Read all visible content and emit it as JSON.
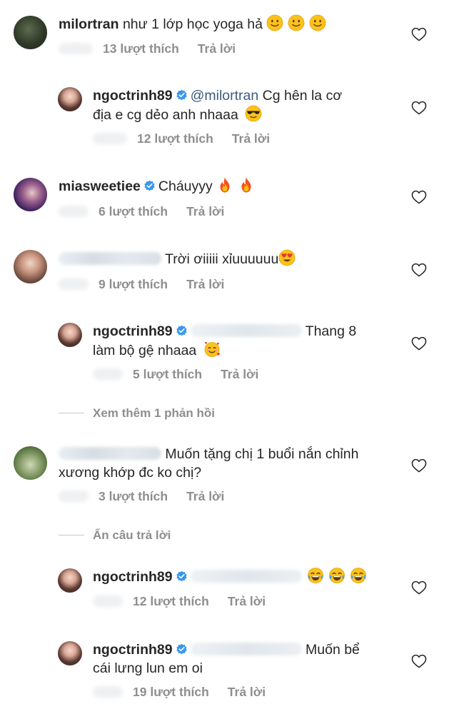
{
  "comments": [
    {
      "username": "milortran",
      "text": "như 1 lớp học yoga hả",
      "likes": "13 lượt thích",
      "reply_label": "Trả lời",
      "emojis": [
        "slightly-smiling-face",
        "slightly-smiling-face",
        "slightly-smiling-face"
      ]
    },
    {
      "username": "ngoctrinh89",
      "mention": "@milortran",
      "text_line1": "Cg hên la cơ",
      "text_line2": "địa e cg dẻo anh nhaaa",
      "likes": "12 lượt thích",
      "reply_label": "Trả lời",
      "emojis": [
        "sunglasses-face"
      ]
    },
    {
      "username": "miasweetiee",
      "text": "Cháuyyy",
      "likes": "6 lượt thích",
      "reply_label": "Trả lời",
      "emojis": [
        "fire",
        "fire"
      ]
    },
    {
      "text": "Trời ơiiiii xỉuuuuuu",
      "likes": "9 lượt thích",
      "reply_label": "Trả lời",
      "emojis": [
        "heart-eyes-face"
      ]
    },
    {
      "username": "ngoctrinh89",
      "text_line1": "Thang 8",
      "text_line2": "làm bộ gệ nhaaa",
      "likes": "5 lượt thích",
      "reply_label": "Trả lời",
      "emojis": [
        "smiling-face-with-hearts"
      ]
    },
    {
      "text_line1": "Muốn tặng chị 1 buổi nắn chỉnh",
      "text_line2": "xương khớp đc ko chị?",
      "likes": "3 lượt thích",
      "reply_label": "Trả lời"
    },
    {
      "username": "ngoctrinh89",
      "likes": "12 lượt thích",
      "reply_label": "Trả lời",
      "emojis": [
        "tears-of-joy",
        "tears-of-joy",
        "tears-of-joy"
      ]
    },
    {
      "username": "ngoctrinh89",
      "text_line1": "Muốn bể",
      "text_line2": "cái lưng lun em oi",
      "likes": "19 lượt thích",
      "reply_label": "Trả lời"
    }
  ],
  "view_more_replies": "Xem thêm 1 phản hồi",
  "hide_replies": "Ẩn câu trả lời",
  "colors": {
    "text": "#262626",
    "secondary": "#8e8e8e",
    "mention": "#3b5b7e",
    "verified": "#3897f0"
  }
}
